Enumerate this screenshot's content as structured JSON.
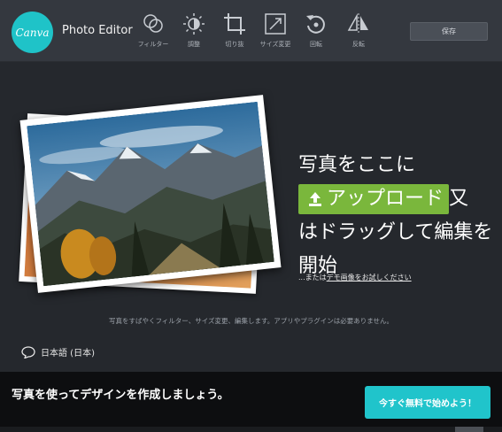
{
  "app": {
    "logo_text": "Canva",
    "title": "Photo Editor"
  },
  "toolbar": {
    "tools": [
      {
        "label": "フィルター",
        "icon": "filter-icon"
      },
      {
        "label": "調整",
        "icon": "brightness-icon"
      },
      {
        "label": "切り抜",
        "icon": "crop-icon"
      },
      {
        "label": "サイズ変更",
        "icon": "resize-icon"
      },
      {
        "label": "回転",
        "icon": "rotate-icon"
      },
      {
        "label": "反転",
        "icon": "flip-icon"
      }
    ],
    "save_label": "保存"
  },
  "upload": {
    "line1": "写真をここに",
    "button_label": "アップロード",
    "line2_suffix": "又",
    "line3": "はドラッグして編集を",
    "line4": "開始",
    "demo_prefix": "...または",
    "demo_link": "デモ画像をお試しください"
  },
  "info": "写真をすばやくフィルター、サイズ変更、編集します。アプリやプラグインは必要ありません。",
  "language": "日本語 (日本)",
  "banner": {
    "text": "写真を使ってデザインを作成しましょう。",
    "cta_label": "今すぐ無料で始めよう！"
  },
  "colors": {
    "accent_teal": "#20c4cb",
    "upload_green": "#7ab73c",
    "background": "#25282d",
    "toolbar": "#34383f"
  }
}
